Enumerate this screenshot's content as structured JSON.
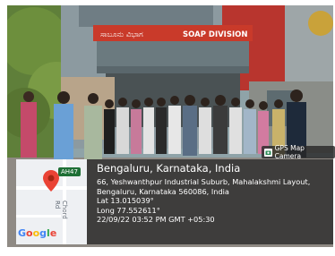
{
  "photo": {
    "building_sign_kannada": "ಸಾಬೂನು ವಿಭಾಗ",
    "building_sign_english": "SOAP DIVISION"
  },
  "gps_badge": {
    "label": "GPS Map Camera",
    "icon": "camera-icon"
  },
  "map": {
    "highway_shield": "AH47",
    "road_label": "Chord Rd",
    "logo_text": "Google",
    "logo_colors": [
      "#4285F4",
      "#EA4335",
      "#FBBC05",
      "#4285F4",
      "#34A853",
      "#EA4335"
    ],
    "pin_color": "#EA4335"
  },
  "location": {
    "title": "Bengaluru, Karnataka, India",
    "address_line1": "66, Yeshwanthpur Industrial Suburb, Mahalakshmi Layout,",
    "address_line2": "Bengaluru, Karnataka 560086, India",
    "latitude": "Lat 13.015039°",
    "longitude": "Long 77.552611°",
    "timestamp": "22/09/22 03:52 PM GMT +05:30"
  }
}
